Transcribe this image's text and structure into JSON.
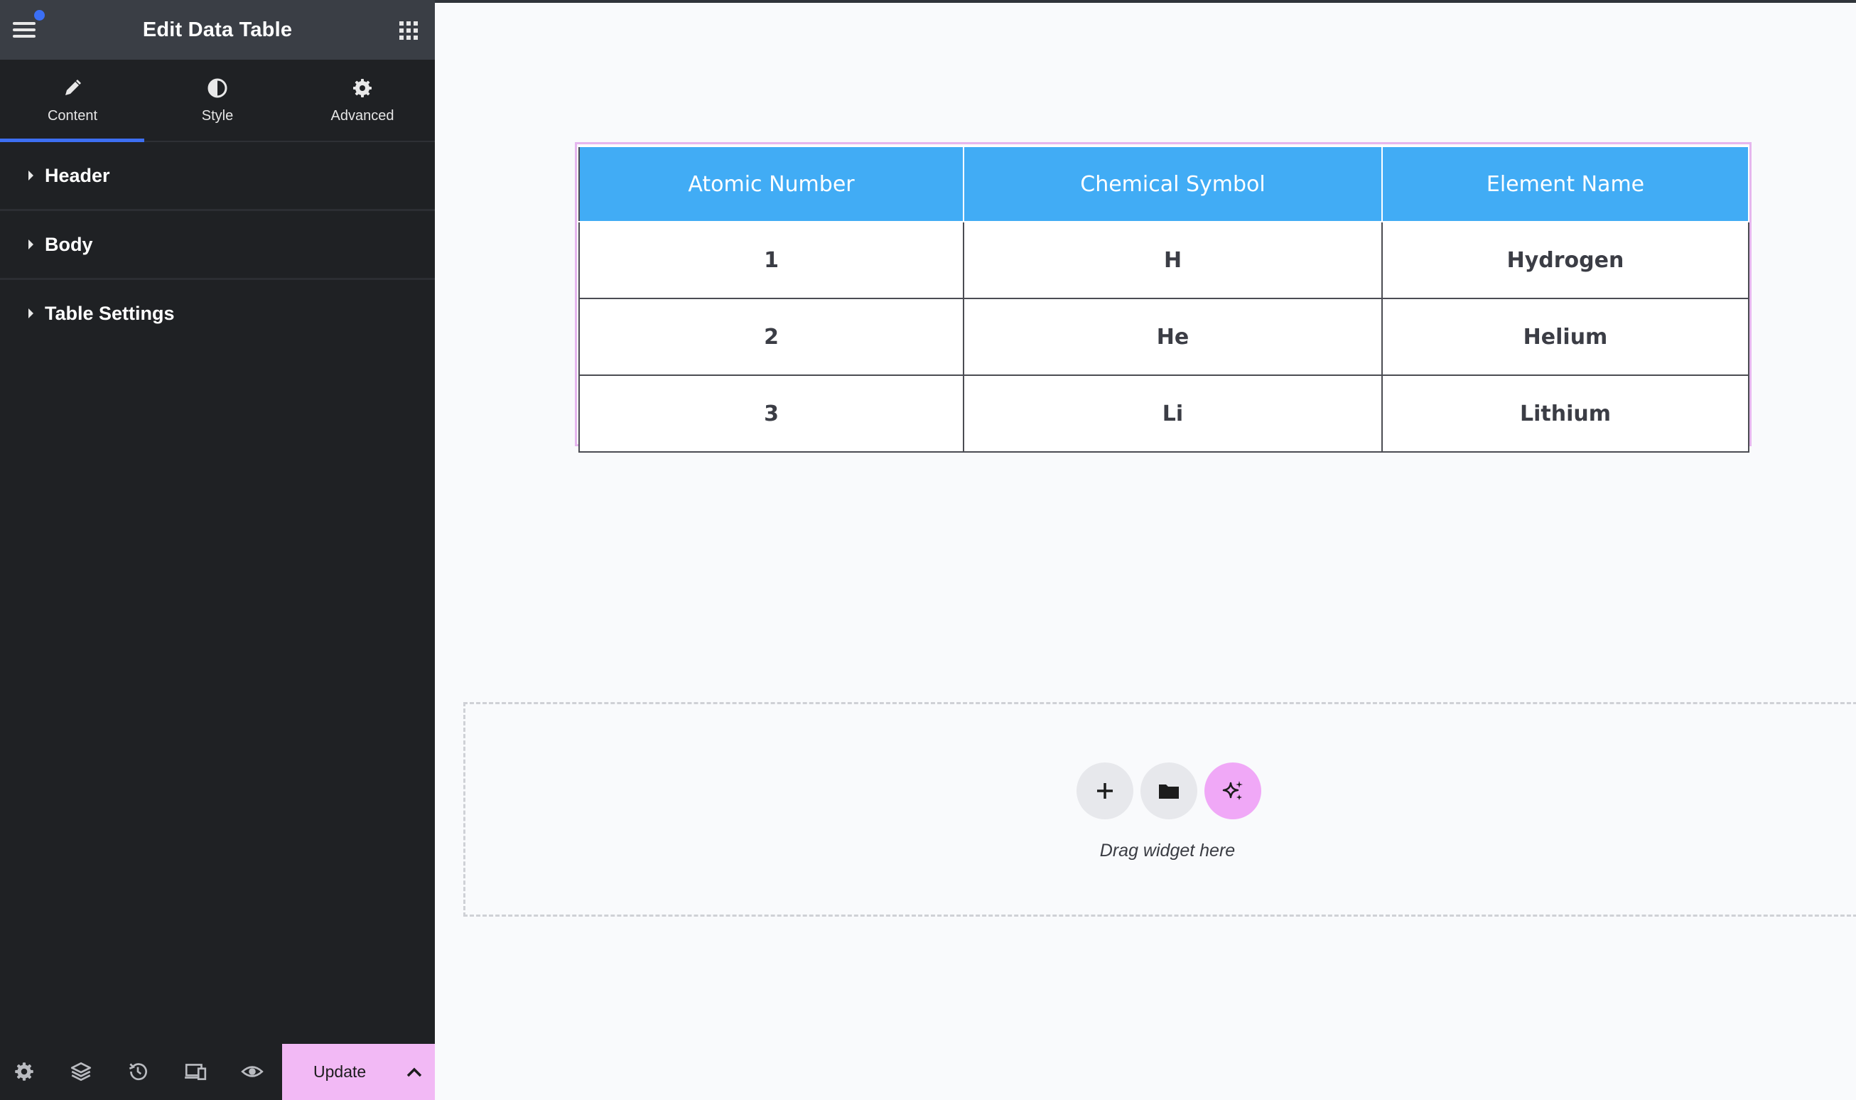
{
  "panel": {
    "title": "Edit Data Table",
    "tabs": [
      {
        "label": "Content",
        "icon": "pencil-icon",
        "active": true
      },
      {
        "label": "Style",
        "icon": "contrast-icon",
        "active": false
      },
      {
        "label": "Advanced",
        "icon": "gear-icon",
        "active": false
      }
    ],
    "sections": [
      {
        "label": "Header"
      },
      {
        "label": "Body"
      },
      {
        "label": "Table Settings"
      }
    ],
    "footer": {
      "icons": [
        "settings-icon",
        "layers-icon",
        "history-icon",
        "responsive-icon",
        "preview-icon"
      ],
      "update_label": "Update"
    }
  },
  "table": {
    "headers": [
      "Atomic Number",
      "Chemical Symbol",
      "Element Name"
    ],
    "rows": [
      [
        "1",
        "H",
        "Hydrogen"
      ],
      [
        "2",
        "He",
        "Helium"
      ],
      [
        "3",
        "Li",
        "Lithium"
      ]
    ]
  },
  "dropzone": {
    "text": "Drag widget here"
  },
  "colors": {
    "accent": "#3d6ff2",
    "header_bg": "#41acf5",
    "update_bg": "#f2b9f5",
    "ai_button_bg": "#f0a8f7"
  }
}
